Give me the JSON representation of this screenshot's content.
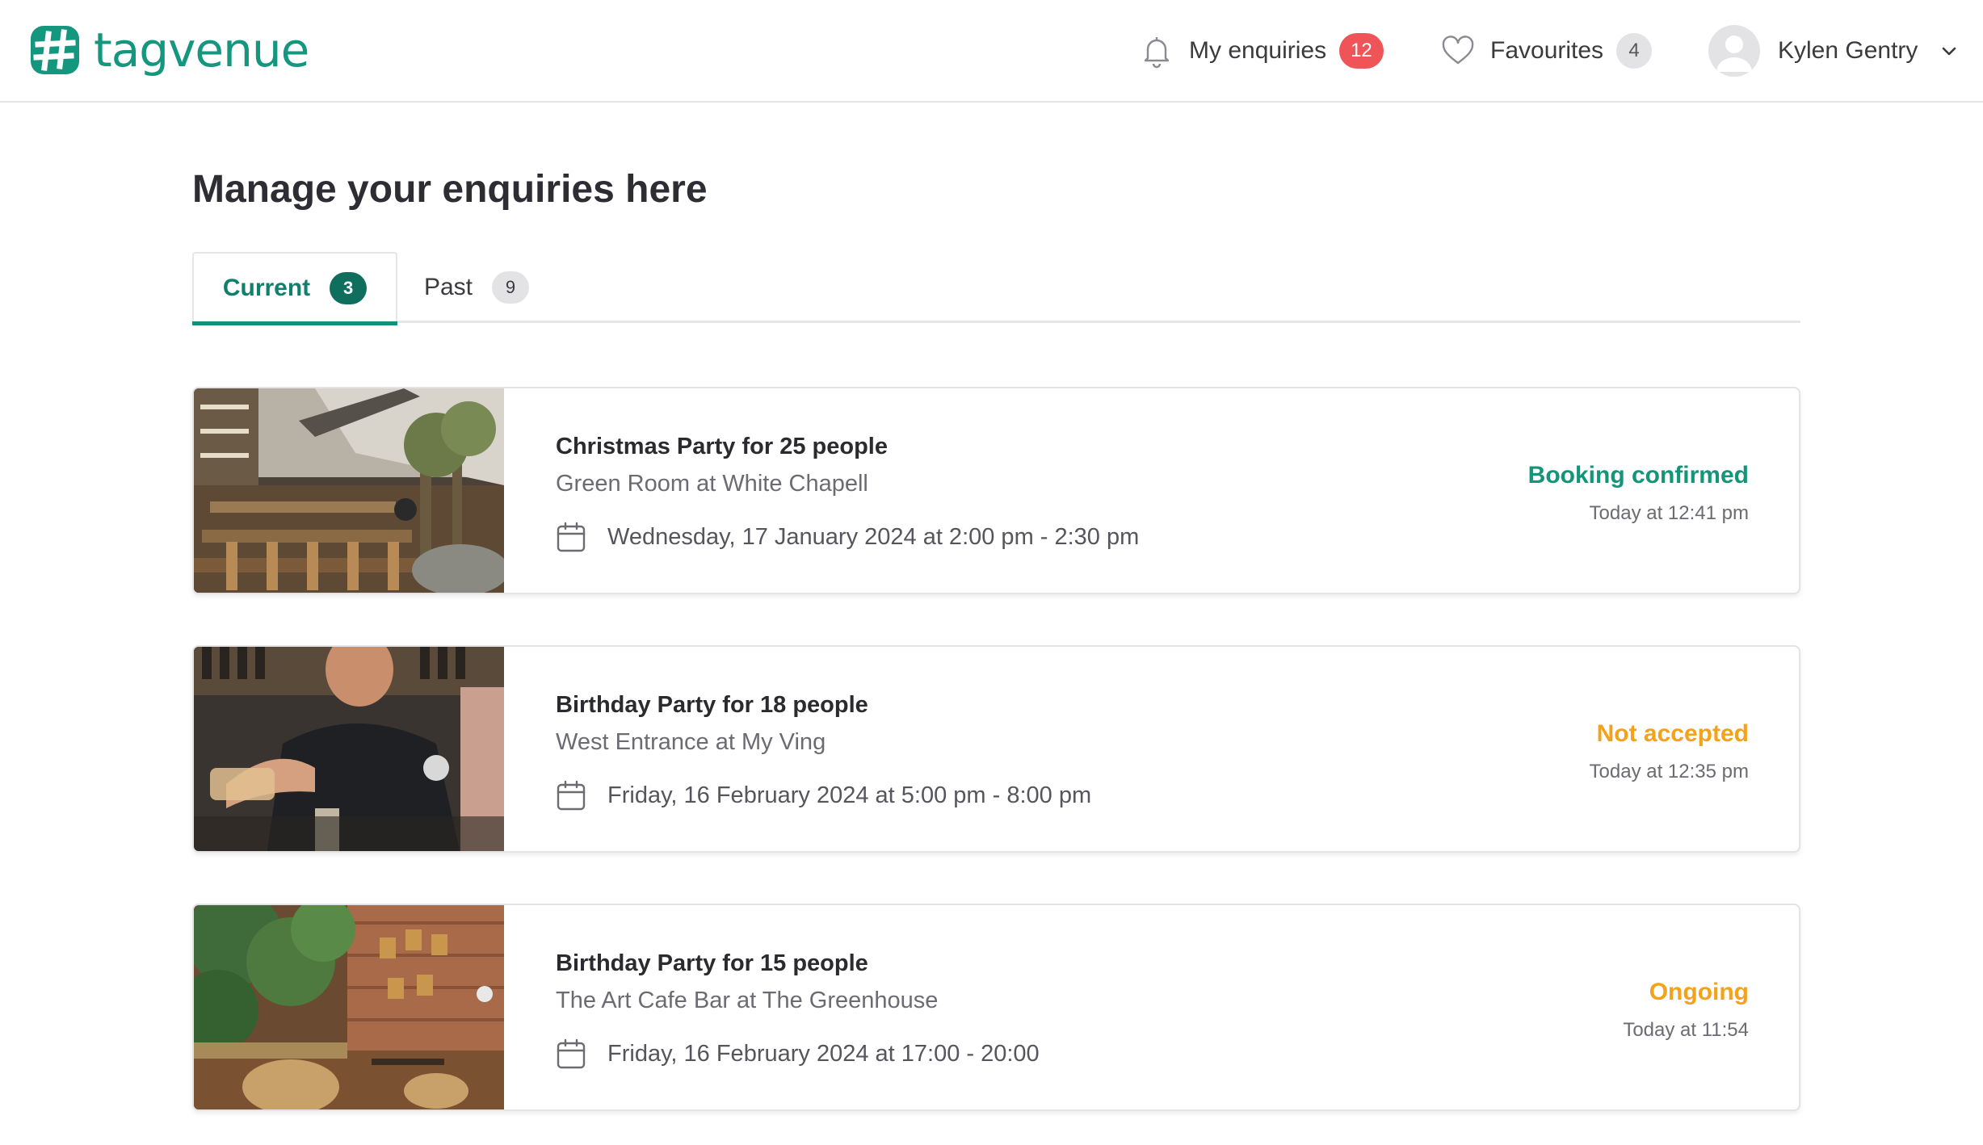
{
  "brand": {
    "name": "tagvenue",
    "color": "#14967f"
  },
  "nav": {
    "enquiries": {
      "label": "My enquiries",
      "count": "12"
    },
    "favourites": {
      "label": "Favourites",
      "count": "4"
    },
    "user": {
      "name": "Kylen Gentry"
    }
  },
  "page": {
    "title": "Manage your enquiries here"
  },
  "tabs": [
    {
      "label": "Current",
      "count": "3",
      "active": true
    },
    {
      "label": "Past",
      "count": "9",
      "active": false
    }
  ],
  "enquiries": [
    {
      "title": "Christmas Party for 25 people",
      "venue": "Green Room at White Chapell",
      "date": "Wednesday, 17 January 2024 at 2:00 pm - 2:30 pm",
      "status": "Booking confirmed",
      "status_color": "#149479",
      "updated": "Today at 12:41 pm"
    },
    {
      "title": "Birthday Party for 18 people",
      "venue": "West Entrance at My Ving",
      "date": "Friday, 16 February 2024 at 5:00 pm - 8:00 pm",
      "status": "Not accepted",
      "status_color": "#f3a21a",
      "updated": "Today at 12:35 pm"
    },
    {
      "title": "Birthday Party for 15 people",
      "venue": "The Art Cafe Bar at The Greenhouse",
      "date": "Friday, 16 February 2024 at 17:00 - 20:00",
      "status": "Ongoing",
      "status_color": "#f3a21a",
      "updated": "Today at 11:54"
    }
  ]
}
